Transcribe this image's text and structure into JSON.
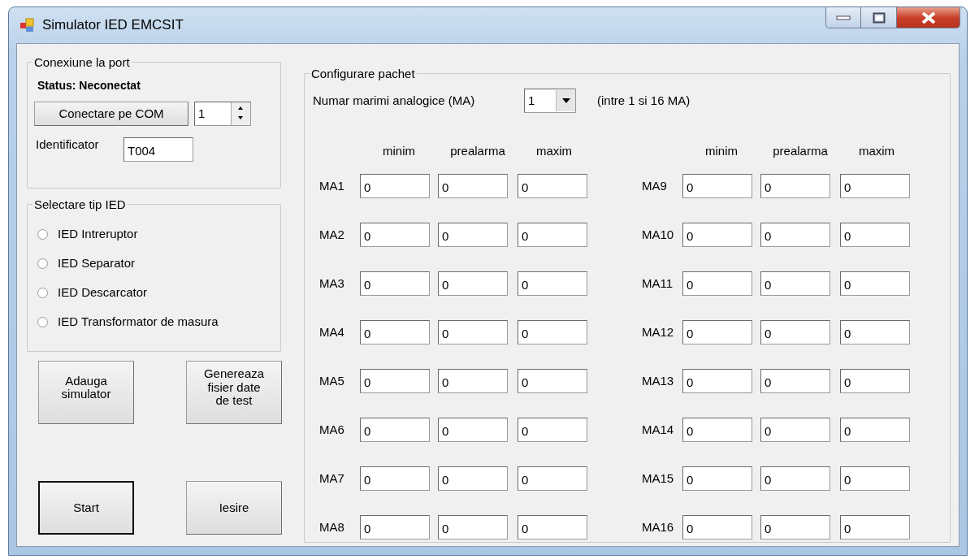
{
  "window": {
    "title": "Simulator IED EMCSIT"
  },
  "port_group": {
    "title": "Conexiune la port",
    "status_label": "Status:",
    "status_value": "Neconectat",
    "connect_button": "Conectare pe COM",
    "com_port": "1",
    "identifier_label": "Identificator",
    "identifier_value": "T004"
  },
  "ied_group": {
    "title": "Selectare tip IED",
    "options": [
      {
        "label": "IED Intreruptor",
        "selected": false
      },
      {
        "label": "IED Separator",
        "selected": false
      },
      {
        "label": "IED Descarcator",
        "selected": false
      },
      {
        "label": "IED Transformator de masura",
        "selected": false
      }
    ]
  },
  "buttons": [
    {
      "label": "Adauga\nsimulator",
      "default": false
    },
    {
      "label": "Genereaza\nfisier date\nde test",
      "default": false
    },
    {
      "label": "Start",
      "default": true
    },
    {
      "label": "Iesire",
      "default": false
    }
  ],
  "packet_group": {
    "title": "Configurare pachet",
    "count_label": "Numar marimi analogice (MA)",
    "count_value": "1",
    "count_hint": "(intre 1 si 16 MA)",
    "columns": [
      "minim",
      "prealarma",
      "maxim"
    ],
    "columns_right": [
      "minim",
      "prealarma",
      "maxim"
    ],
    "rows": [
      {
        "label": "MA1",
        "values": [
          "0",
          "0",
          "0"
        ]
      },
      {
        "label": "MA2",
        "values": [
          "0",
          "0",
          "0"
        ]
      },
      {
        "label": "MA3",
        "values": [
          "0",
          "0",
          "0"
        ]
      },
      {
        "label": "MA4",
        "values": [
          "0",
          "0",
          "0"
        ]
      },
      {
        "label": "MA5",
        "values": [
          "0",
          "0",
          "0"
        ]
      },
      {
        "label": "MA6",
        "values": [
          "0",
          "0",
          "0"
        ]
      },
      {
        "label": "MA7",
        "values": [
          "0",
          "0",
          "0"
        ]
      },
      {
        "label": "MA8",
        "values": [
          "0",
          "0",
          "0"
        ]
      },
      {
        "label": "MA9",
        "values": [
          "0",
          "0",
          "0"
        ]
      },
      {
        "label": "MA10",
        "values": [
          "0",
          "0",
          "0"
        ]
      },
      {
        "label": "MA11",
        "values": [
          "0",
          "0",
          "0"
        ]
      },
      {
        "label": "MA12",
        "values": [
          "0",
          "0",
          "0"
        ]
      },
      {
        "label": "MA13",
        "values": [
          "0",
          "0",
          "0"
        ]
      },
      {
        "label": "MA14",
        "values": [
          "0",
          "0",
          "0"
        ]
      },
      {
        "label": "MA15",
        "values": [
          "0",
          "0",
          "0"
        ]
      },
      {
        "label": "MA16",
        "values": [
          "0",
          "0",
          "0"
        ]
      }
    ]
  }
}
